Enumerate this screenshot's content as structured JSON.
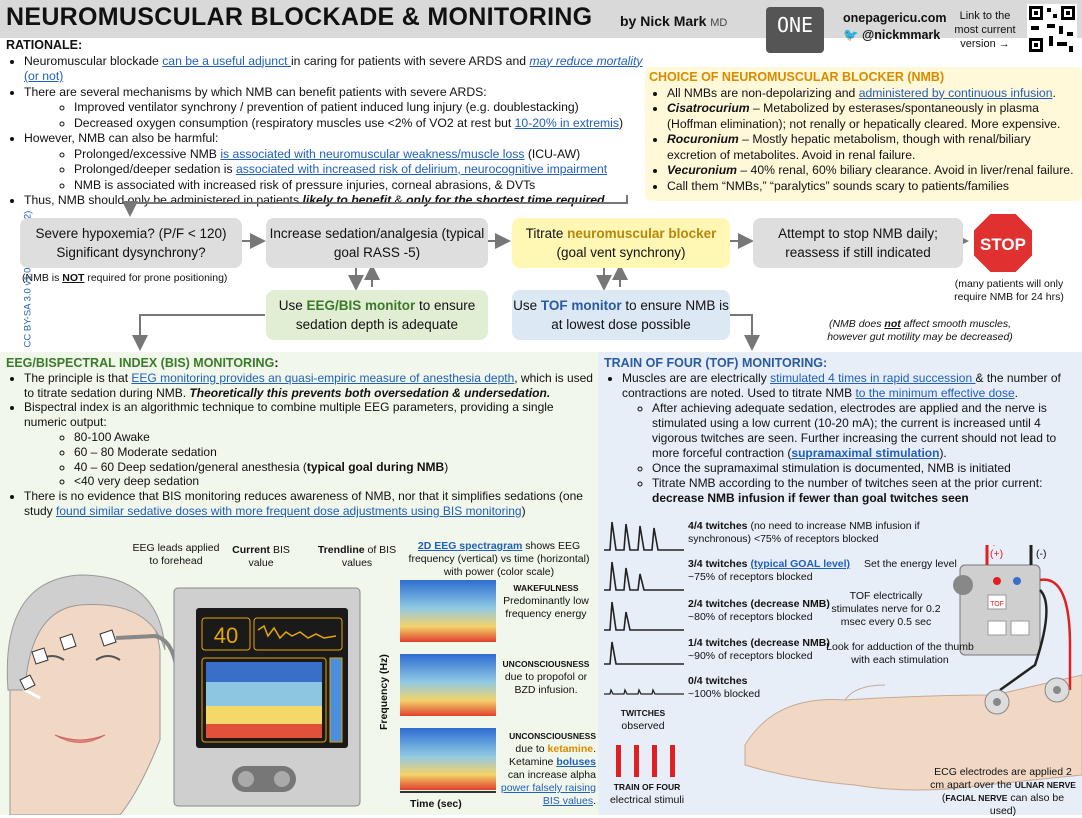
{
  "header": {
    "title": "NEUROMUSCULAR BLOCKADE & MONITORING",
    "by": "by Nick Mark",
    "md": "MD",
    "logo": "ONE",
    "site": "onepagericu.com",
    "twitter": "@nickmmark",
    "link_text": "Link to the most current version →"
  },
  "license": "CC BY-SA 3.0 v1.0 (2021-11-02)",
  "rationale": {
    "heading": "RATIONALE:",
    "b1_pre": "Neuromuscular blockade ",
    "b1_link": "can be a useful adjunct ",
    "b1_mid": "in caring for patients with severe ARDS and ",
    "b1_link2": "may reduce mortality",
    "b1_link3": "(or not)",
    "b2": "There are several mechanisms by which NMB can benefit patients with severe ARDS:",
    "b2a": "Improved ventilator synchrony / prevention of patient induced lung injury (e.g. doublestacking)",
    "b2b_pre": "Decreased oxygen consumption (respiratory muscles use <2% of VO2 at rest but ",
    "b2b_link": "10-20% in extremis",
    "b2b_post": ")",
    "b3": "However, NMB can also be harmful:",
    "b3a_pre": "Prolonged/excessive NMB ",
    "b3a_link": "is associated with neuromuscular weakness/muscle loss",
    "b3a_post": " (ICU-AW)",
    "b3b_pre": "Prolonged/deeper sedation is ",
    "b3b_link": "associated with increased risk of delirium, neurocognitive impairment",
    "b3c": "NMB is associated with increased risk of pressure injuries, corneal abrasions, & DVTs",
    "b4_pre": "Thus, NMB should only be administered in patients ",
    "b4_em1": "likely to benefit",
    "b4_mid": " & ",
    "b4_em2": "only for the shortest time required",
    "b4_post": "."
  },
  "nmb_choice": {
    "heading": "CHOICE OF NEUROMUSCULAR BLOCKER (NMB)",
    "i1_pre": "All NMBs are non-depolarizing and ",
    "i1_link": "administered by continuous infusion",
    "i1_post": ".",
    "i2_name": "Cisatrocurium",
    "i2_text": " – Metabolized by esterases/spontaneously in plasma (Hoffman elimination); not renally or hepatically cleared. More expensive.",
    "i3_name": "Rocuronium",
    "i3_text": " – Mostly hepatic metabolism, though with renal/biliary excretion of metabolites. Avoid in renal failure.",
    "i4_name": "Vecuronium",
    "i4_text": " – 40% renal, 60% biliary clearance. Avoid in liver/renal failure.",
    "i5": "Call them “NMBs,” “paralytics” sounds scary to patients/families"
  },
  "flow": {
    "box1": "Severe hypoxemia? (P/F < 120) Significant dysynchrony?",
    "box1_note_pre": "(NMB is ",
    "box1_note_em": "NOT",
    "box1_note_post": " required for prone positioning)",
    "box2": "Increase sedation/analgesia (typical goal RASS -5)",
    "box3_pre": "Titrate ",
    "box3_em": "neuromuscular blocker",
    "box3_post": " (goal vent synchrony)",
    "box4": "Attempt to stop NMB daily; reassess if still indicated",
    "stop": "STOP",
    "stop_note": "(many patients will only require NMB for 24 hrs)",
    "eeg_pre": "Use ",
    "eeg_em": "EEG/BIS monitor",
    "eeg_post": " to ensure sedation depth is adequate",
    "tof_pre": "Use ",
    "tof_em": "TOF monitor",
    "tof_post": " to ensure NMB is at lowest dose possible",
    "smooth_pre": "(NMB does ",
    "smooth_em": "not",
    "smooth_post": " affect smooth muscles, however gut motility may be decreased)"
  },
  "eeg": {
    "heading": "EEG/BISPECTRAL INDEX (BIS) MONITORING",
    "p1_pre": "The principle is that ",
    "p1_link": "EEG monitoring provides an quasi-empiric measure of anesthesia depth",
    "p1_mid": ", which is used to titrate sedation during NMB. ",
    "p1_em": "Theoretically this prevents both oversedation & undersedation.",
    "p2": "Bispectral index is an algorithmic technique to combine multiple EEG parameters, providing a single numeric output:",
    "r1": "80-100 Awake",
    "r2": "60 – 80 Moderate sedation",
    "r3_pre": "40 – 60 Deep sedation/general anesthesia (",
    "r3_em": "typical goal during NMB",
    "r3_post": ")",
    "r4": "<40 very deep sedation",
    "p3": "There is no evidence that BIS monitoring reduces awareness of NMB, nor that it simplifies sedations (one study ",
    "p3_link": "found similar sedative doses with more frequent dose adjustments using BIS monitoring",
    "p3_post": ")",
    "lbl_leads": "EEG leads applied to forehead",
    "lbl_current_em": "Current",
    "lbl_current": " BIS value",
    "lbl_trend_em": "Trendline",
    "lbl_trend": " of BIS values",
    "bis_value": "40",
    "spec_link": "2D EEG spectragram",
    "spec_desc": " shows EEG frequency (vertical) vs time (horizontal) with power (color scale)",
    "wake_head": "WAKEFULNESS",
    "wake_text": "Predominantly low frequency energy",
    "unc1_head": "UNCONSCIOUSNESS",
    "unc1_text": "due to propofol or BZD infusion.",
    "unc2_head": "UNCONSCIOUSNESS",
    "unc2_pre": "due to ",
    "unc2_em": "ketamine",
    "unc2_mid": ". Ketamine ",
    "unc2_link": "boluses",
    "unc2_text": " can increase alpha ",
    "unc2_link2": "power falsely raising BIS values",
    "unc2_post": ".",
    "axis_y": "Frequency (Hz)",
    "axis_x": "Time (sec)"
  },
  "tof": {
    "heading": "TRAIN OF FOUR (TOF) MONITORING:",
    "p1_pre": "Muscles are are electrically ",
    "p1_link": "stimulated 4 times in rapid succession ",
    "p1_mid": "& the number of contractions are noted. Used to titrate NMB ",
    "p1_link2": "to the minimum effective dose",
    "p1_post": ".",
    "s1": "After achieving adequate sedation, electrodes are applied and the nerve is stimulated using a low current (10-20 mA); the current is increased until 4 vigorous twitches are seen. Further increasing the current should not lead to more forceful contraction (",
    "s1_link": "supramaximal stimulation",
    "s1_post": ").",
    "s2": "Once the supramaximal stimulation is documented, NMB is initiated",
    "s3": "Titrate NMB according to the number of twitches seen at the prior current:",
    "s3_em": "decrease NMB infusion if fewer than goal twitches seen",
    "t4_head": "4/4 twitches",
    "t4_text": " (no need to increase NMB infusion if synchronous) <75% of receptors blocked",
    "t3_head": "3/4 twitches",
    "t3_link": "(typical GOAL level)",
    "t3_text": "~75% of receptors blocked",
    "t2_head": "2/4 twitches",
    "t2_em": "(decrease NMB)",
    "t2_text": "~80% of receptors blocked",
    "t1_head": "1/4 twitches",
    "t1_em": "(decrease NMB)",
    "t1_text": "~90% of receptors blocked",
    "t0_head": "0/4 twitches",
    "t0_text": "~100% blocked",
    "twitch_obs_head": "TWITCHES",
    "twitch_obs": "observed",
    "tof_stim_head": "TRAIN OF FOUR",
    "tof_stim": "electrical stimuli",
    "energy": "Set the energy level",
    "tof_elec": "TOF electrically stimulates nerve for 0.2 msec every 0.5 sec",
    "thumb": "Look for adduction of the thumb with each stimulation",
    "plus": "(+)",
    "minus": "(-)",
    "ecg_pre": "ECG electrodes are applied 2 cm apart over the ",
    "ecg_em": "ULNAR NERVE",
    "ecg_post_pre": " (",
    "ecg_em2": "FACIAL NERVE",
    "ecg_post": " can also be used)",
    "device_tof": "TOF"
  },
  "colors": {
    "accent_orange": "#d98b00",
    "link_blue": "#1f5fbf",
    "stop_red": "#e03030"
  }
}
